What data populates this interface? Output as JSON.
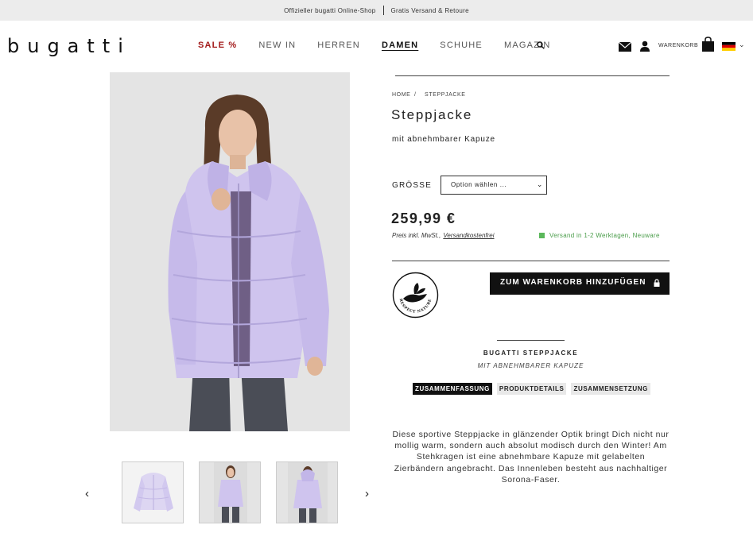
{
  "topbar": {
    "left": "Offizieller bugatti Online-Shop",
    "right": "Gratis Versand & Retoure"
  },
  "header": {
    "logo": "bugatti",
    "nav": [
      "SALE %",
      "NEW IN",
      "HERREN",
      "DAMEN",
      "SCHUHE",
      "MAGAZIN"
    ],
    "active_nav": "DAMEN",
    "cart_label": "WARENKORB",
    "icons": [
      "search-icon",
      "mail-icon",
      "user-icon",
      "bag-icon",
      "flag-de-icon"
    ]
  },
  "gallery": {
    "prev_icon": "‹",
    "next_icon": "›",
    "thumbnails": [
      "front-white",
      "model-front",
      "model-back"
    ],
    "active_thumbnail": 1
  },
  "product": {
    "breadcrumb": [
      "HOME",
      "STEPPJACKE"
    ],
    "breadcrumb_sep": "/",
    "title": "Steppjacke",
    "subtitle": "mit abnehmbarer Kapuze",
    "size_label": "GRÖSSE",
    "size_select": "Option wählen ...",
    "price": "259,99 €",
    "price_note": "Preis inkl. MwSt.,",
    "price_note_link": "Versandkostenfrei",
    "shipping": "Versand in 1-2 Werktagen, Neuware",
    "badge_text": "RESPECT NATURE",
    "add_to_cart": "ZUM WARENKORB HINZUFÜGEN"
  },
  "description": {
    "title": "BUGATTI STEPPJACKE",
    "subtitle": "MIT ABNEHMBARER KAPUZE",
    "tabs": [
      "ZUSAMMENFASSUNG",
      "PRODUKTDETAILS",
      "ZUSAMMENSETZUNG"
    ],
    "active_tab": "ZUSAMMENFASSUNG",
    "body": "Diese sportive Steppjacke in glänzender Optik bringt Dich nicht nur mollig warm, sondern auch absolut modisch durch den Winter! Am Stehkragen ist eine abnehmbare Kapuze mit gelabelten Zierbändern angebracht. Das Innenleben besteht aus nachhaltiger Sorona-Faser."
  },
  "colors": {
    "jacket": "#cfc4ee",
    "sale": "#a31b1b",
    "shipping": "#5bb85b",
    "button": "#111111"
  }
}
